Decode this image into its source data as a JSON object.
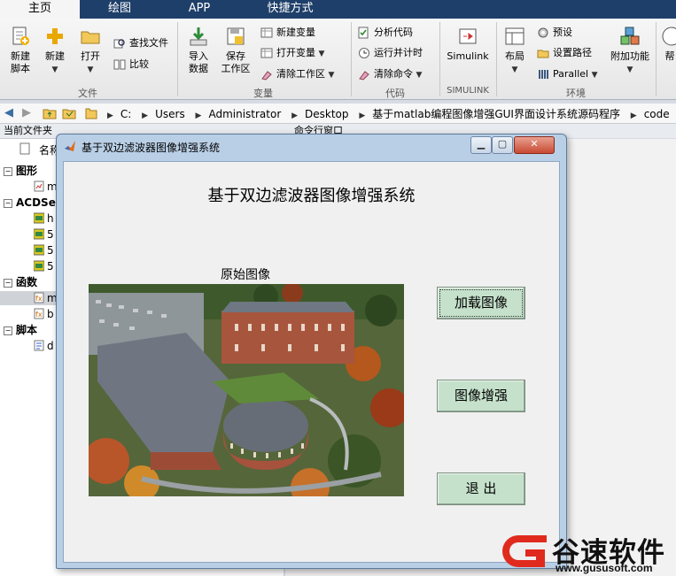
{
  "tabs": [
    "主页",
    "绘图",
    "APP",
    "快捷方式"
  ],
  "ribbon": {
    "file": {
      "new_script": "新建\n脚本",
      "new": "新建",
      "open": "打开",
      "find_files": "查找文件",
      "compare": "比较",
      "label": "文件"
    },
    "variable": {
      "import": "导入\n数据",
      "save_ws": "保存\n工作区",
      "new_var": "新建变量",
      "open_var": "打开变量",
      "clear_ws": "清除工作区",
      "label": "变量"
    },
    "code": {
      "analyze": "分析代码",
      "run_time": "运行并计时",
      "clear_cmd": "清除命令",
      "label": "代码"
    },
    "simulink": {
      "btn": "Simulink",
      "label": "SIMULINK"
    },
    "env": {
      "layout": "布局",
      "prefs": "预设",
      "set_path": "设置路径",
      "parallel": "Parallel",
      "addons": "附加功能",
      "label": "环境"
    },
    "help": "帮"
  },
  "address": {
    "crumbs": [
      "C:",
      "Users",
      "Administrator",
      "Desktop",
      "基于matlab编程图像增强GUI界面设计系统源码程序",
      "code"
    ]
  },
  "left": {
    "header": "当前文件夹",
    "col_name": "名称",
    "groups": [
      {
        "title": "图形",
        "items": [
          "m"
        ]
      },
      {
        "title": "ACDSee",
        "items": [
          "h",
          "5",
          "5",
          "5"
        ]
      },
      {
        "title": "函数",
        "items": [
          "m",
          "b"
        ]
      },
      {
        "title": "脚本",
        "items": [
          "d"
        ]
      }
    ]
  },
  "cmd_header": "命令行窗口",
  "figure": {
    "window_title": "基于双边滤波器图像增强系统",
    "app_title": "基于双边滤波器图像增强系统",
    "image_label": "原始图像",
    "btn_load": "加载图像",
    "btn_enhance": "图像增强",
    "btn_exit": "退  出"
  },
  "watermark": {
    "brand": "谷速软件",
    "url": "www.gususoft.com"
  },
  "colors": {
    "button_green": "#c5e1cb",
    "tabbar": "#1e3f69",
    "watermark_red": "#e02a1e"
  }
}
